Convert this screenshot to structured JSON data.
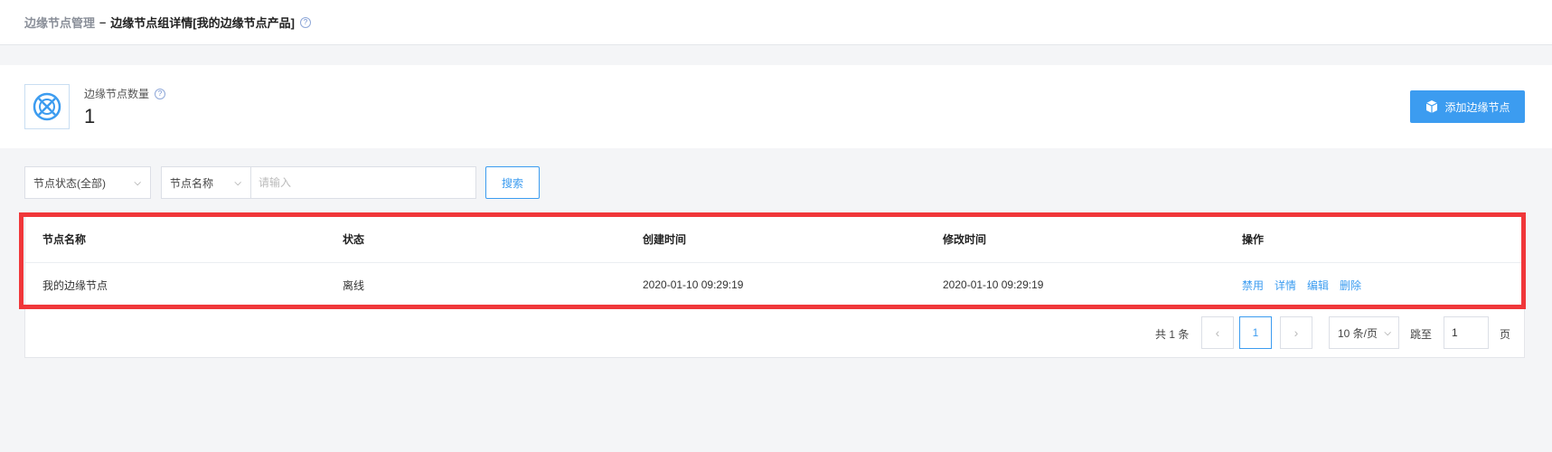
{
  "breadcrumb": {
    "parent": "边缘节点管理",
    "separator": "–",
    "current": "边缘节点组详情[我的边缘节点产品]",
    "help_icon": "help-circle-icon"
  },
  "summary": {
    "icon": "edge-node-icon",
    "label": "边缘节点数量",
    "count": "1",
    "add_button": "添加边缘节点",
    "add_icon": "cube-icon"
  },
  "filters": {
    "status_select": "节点状态(全部)",
    "field_select": "节点名称",
    "search_placeholder": "请输入",
    "search_button": "搜索"
  },
  "table": {
    "columns": [
      "节点名称",
      "状态",
      "创建时间",
      "修改时间",
      "操作"
    ],
    "rows": [
      {
        "name": "我的边缘节点",
        "status": "离线",
        "created": "2020-01-10 09:29:19",
        "modified": "2020-01-10 09:29:19",
        "actions": [
          "禁用",
          "详情",
          "编辑",
          "删除"
        ]
      }
    ]
  },
  "pagination": {
    "total": "共 1 条",
    "prev": "‹",
    "next": "›",
    "current_page": "1",
    "page_size": "10 条/页",
    "jump_label": "跳至",
    "jump_value": "1",
    "page_unit": "页"
  },
  "colors": {
    "accent": "#3c9cf0",
    "highlight": "#f0373a"
  }
}
